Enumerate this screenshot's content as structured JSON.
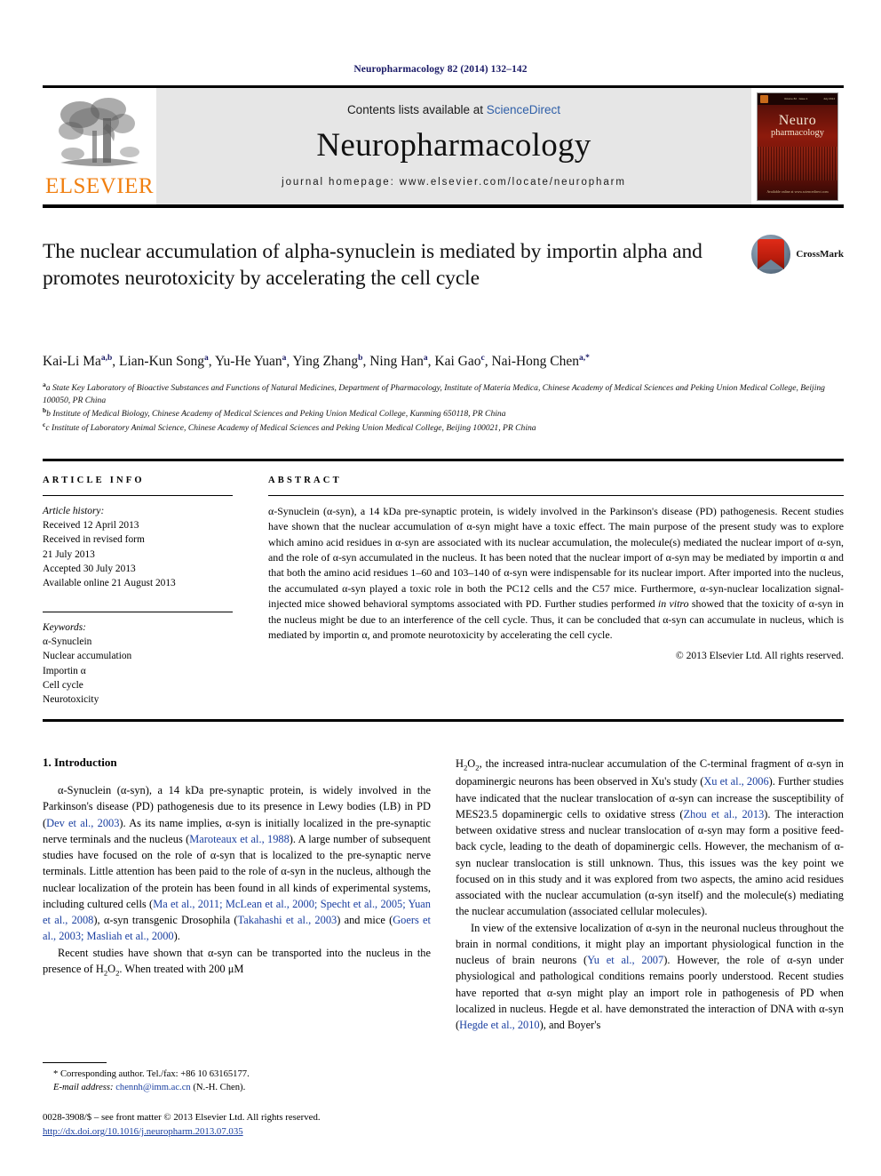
{
  "running_head": "Neuropharmacology 82 (2014) 132–142",
  "masthead": {
    "contents_prefix": "Contents lists available at ",
    "sciencedirect": "ScienceDirect",
    "journal_title": "Neuropharmacology",
    "homepage": "journal homepage: www.elsevier.com/locate/neuropharm",
    "publisher": "ELSEVIER",
    "cover": {
      "line1": "Neuro",
      "line2": "pharmacology",
      "topbar_left": "Volume 82 · Issue 1",
      "topbar_right": "July 2014",
      "bottom": "Available online at www.sciencedirect.com"
    }
  },
  "article": {
    "title": "The nuclear accumulation of alpha-synuclein is mediated by importin alpha and promotes neurotoxicity by accelerating the cell cycle",
    "crossmark_label": "CrossMark",
    "authors_html": "Kai-Li Ma<sup>a,b</sup>, Lian-Kun Song<sup>a</sup>, Yu-He Yuan<sup>a</sup>, Ying Zhang<sup>b</sup>, Ning Han<sup>a</sup>, Kai Gao<sup>c</sup>, Nai-Hong Chen<sup>a,*</sup>",
    "affiliations": [
      "a State Key Laboratory of Bioactive Substances and Functions of Natural Medicines, Department of Pharmacology, Institute of Materia Medica, Chinese Academy of Medical Sciences and Peking Union Medical College, Beijing 100050, PR China",
      "b Institute of Medical Biology, Chinese Academy of Medical Sciences and Peking Union Medical College, Kunming 650118, PR China",
      "c Institute of Laboratory Animal Science, Chinese Academy of Medical Sciences and Peking Union Medical College, Beijing 100021, PR China"
    ]
  },
  "article_info": {
    "heading": "ARTICLE INFO",
    "history_label": "Article history:",
    "history": [
      "Received 12 April 2013",
      "Received in revised form",
      "21 July 2013",
      "Accepted 30 July 2013",
      "Available online 21 August 2013"
    ],
    "keywords_label": "Keywords:",
    "keywords": [
      "α-Synuclein",
      "Nuclear accumulation",
      "Importin α",
      "Cell cycle",
      "Neurotoxicity"
    ]
  },
  "abstract": {
    "heading": "ABSTRACT",
    "text": "α-Synuclein (α-syn), a 14 kDa pre-synaptic protein, is widely involved in the Parkinson's disease (PD) pathogenesis. Recent studies have shown that the nuclear accumulation of α-syn might have a toxic effect. The main purpose of the present study was to explore which amino acid residues in α-syn are associated with its nuclear accumulation, the molecule(s) mediated the nuclear import of α-syn, and the role of α-syn accumulated in the nucleus. It has been noted that the nuclear import of α-syn may be mediated by importin α and that both the amino acid residues 1–60 and 103–140 of α-syn were indispensable for its nuclear import. After imported into the nucleus, the accumulated α-syn played a toxic role in both the PC12 cells and the C57 mice. Furthermore, α-syn-nuclear localization signal-injected mice showed behavioral symptoms associated with PD. Further studies performed in vitro showed that the toxicity of α-syn in the nucleus might be due to an interference of the cell cycle. Thus, it can be concluded that α-syn can accumulate in nucleus, which is mediated by importin α, and promote neurotoxicity by accelerating the cell cycle.",
    "copyright": "© 2013 Elsevier Ltd. All rights reserved."
  },
  "introduction": {
    "heading": "1. Introduction",
    "left_paragraphs": [
      "α-Synuclein (α-syn), a 14 kDa pre-synaptic protein, is widely involved in the Parkinson's disease (PD) pathogenesis due to its presence in Lewy bodies (LB) in PD (Dev et al., 2003). As its name implies, α-syn is initially localized in the pre-synaptic nerve terminals and the nucleus (Maroteaux et al., 1988). A large number of subsequent studies have focused on the role of α-syn that is localized to the pre-synaptic nerve terminals. Little attention has been paid to the role of α-syn in the nucleus, although the nuclear localization of the protein has been found in all kinds of experimental systems, including cultured cells (Ma et al., 2011; McLean et al., 2000; Specht et al., 2005; Yuan et al., 2008), α-syn transgenic Drosophila (Takahashi et al., 2003) and mice (Goers et al., 2003; Masliah et al., 2000).",
      "Recent studies have shown that α-syn can be transported into the nucleus in the presence of H2O2. When treated with 200 μM"
    ],
    "right_paragraphs": [
      "H2O2, the increased intra-nuclear accumulation of the C-terminal fragment of α-syn in dopaminergic neurons has been observed in Xu's study (Xu et al., 2006). Further studies have indicated that the nuclear translocation of α-syn can increase the susceptibility of MES23.5 dopaminergic cells to oxidative stress (Zhou et al., 2013). The interaction between oxidative stress and nuclear translocation of α-syn may form a positive feed-back cycle, leading to the death of dopaminergic cells. However, the mechanism of α-syn nuclear translocation is still unknown. Thus, this issues was the key point we focused on in this study and it was explored from two aspects, the amino acid residues associated with the nuclear accumulation (α-syn itself) and the molecule(s) mediating the nuclear accumulation (associated cellular molecules).",
      "In view of the extensive localization of α-syn in the neuronal nucleus throughout the brain in normal conditions, it might play an important physiological function in the nucleus of brain neurons (Yu et al., 2007). However, the role of α-syn under physiological and pathological conditions remains poorly understood. Recent studies have reported that α-syn might play an import role in pathogenesis of PD when localized in nucleus. Hegde et al. have demonstrated the interaction of DNA with α-syn (Hegde et al., 2010), and Boyer's"
    ]
  },
  "footnotes": {
    "corresponding": "* Corresponding author. Tel./fax: +86 10 63165177.",
    "email_label": "E-mail address:",
    "email": "chennh@imm.ac.cn",
    "email_suffix": "(N.-H. Chen).",
    "issn_line": "0028-3908/$ – see front matter © 2013 Elsevier Ltd. All rights reserved.",
    "doi": "http://dx.doi.org/10.1016/j.neuropharm.2013.07.035"
  },
  "colors": {
    "link": "#1a3fa0",
    "sciencedirect": "#2f5fa8",
    "elsevier_orange": "#F07F10",
    "masthead_bg": "#e6e6e6"
  }
}
